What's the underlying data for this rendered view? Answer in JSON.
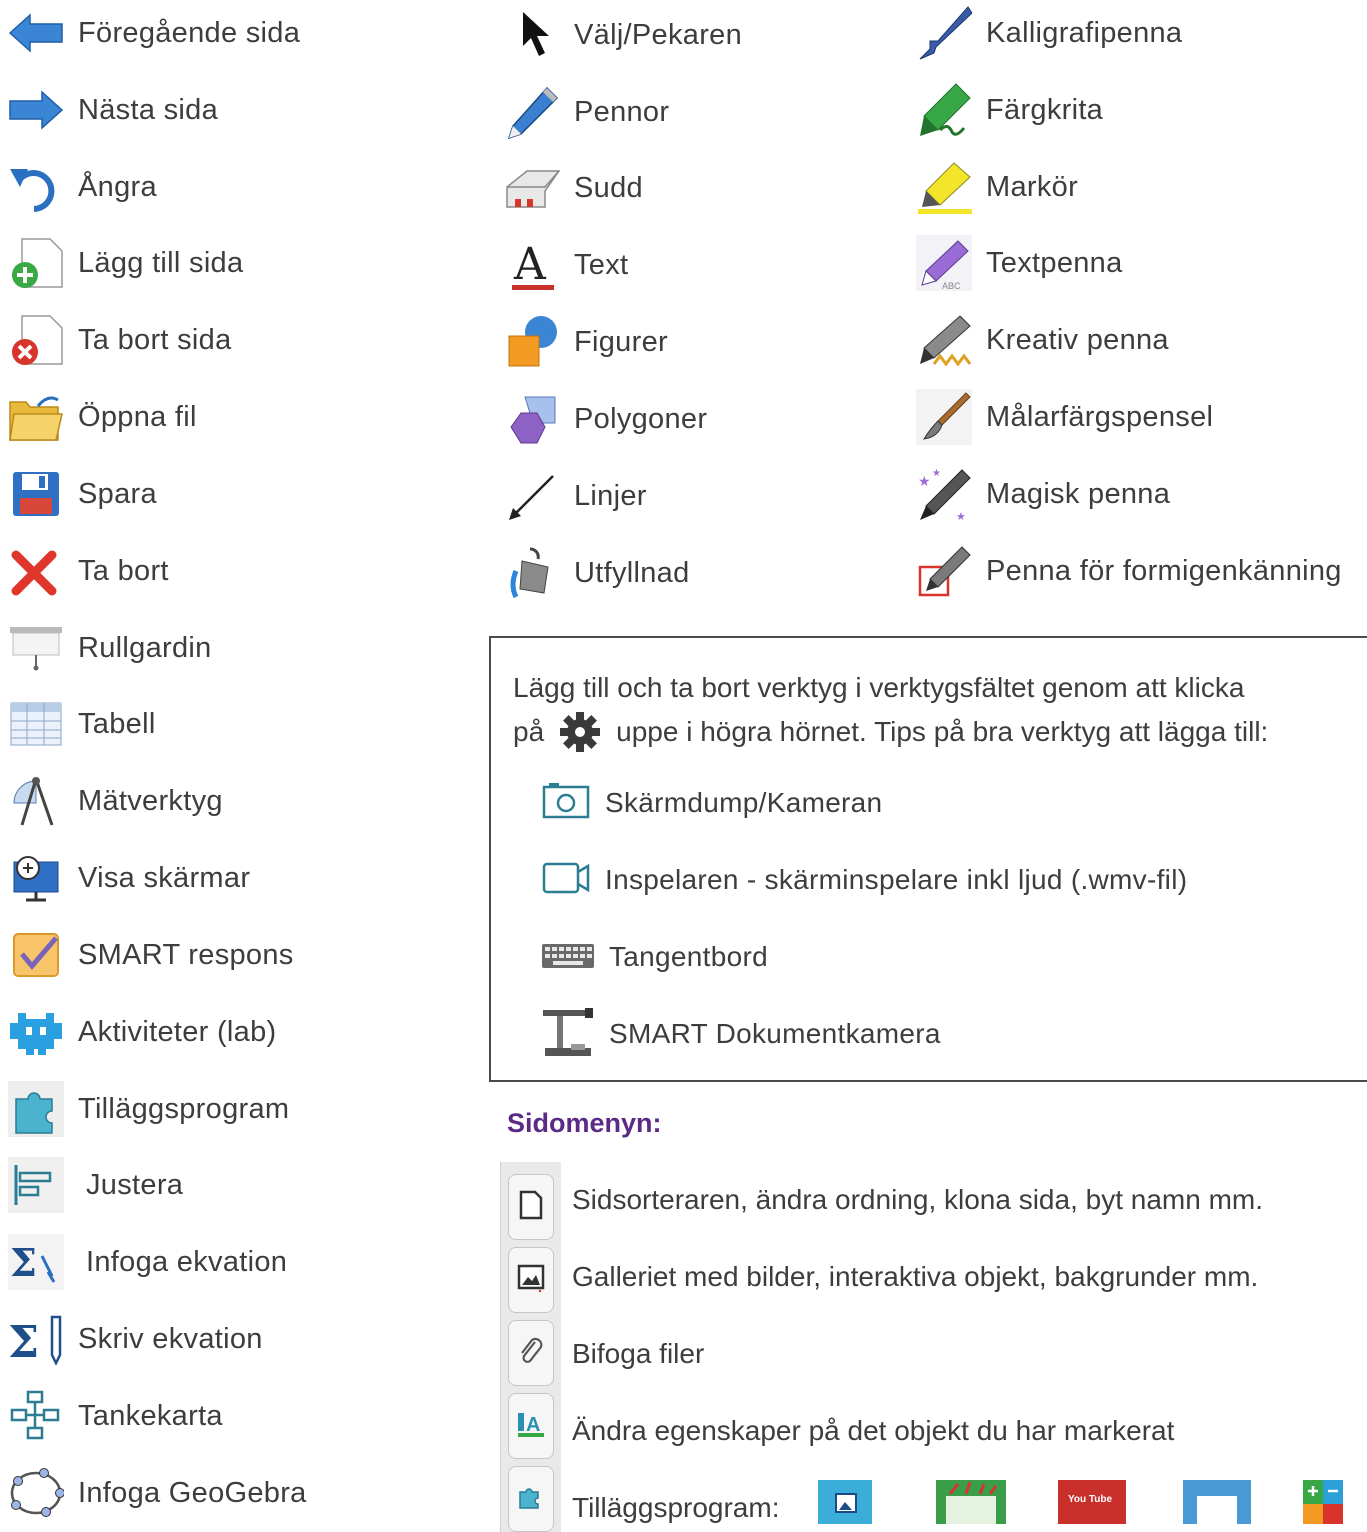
{
  "column1": [
    {
      "label": "Föregående sida",
      "icon": "arrow-left-icon"
    },
    {
      "label": "Nästa sida",
      "icon": "arrow-right-icon"
    },
    {
      "label": "Ångra",
      "icon": "undo-icon"
    },
    {
      "label": "Lägg till sida",
      "icon": "add-page-icon"
    },
    {
      "label": "Ta bort sida",
      "icon": "delete-page-icon"
    },
    {
      "label": "Öppna fil",
      "icon": "open-folder-icon"
    },
    {
      "label": "Spara",
      "icon": "save-icon"
    },
    {
      "label": "Ta bort",
      "icon": "delete-icon"
    },
    {
      "label": "Rullgardin",
      "icon": "screen-shade-icon"
    },
    {
      "label": "Tabell",
      "icon": "table-icon"
    },
    {
      "label": "Mätverktyg",
      "icon": "measurement-tools-icon"
    },
    {
      "label": "Visa skärmar",
      "icon": "view-screens-icon"
    },
    {
      "label": "SMART respons",
      "icon": "smart-response-icon"
    },
    {
      "label": "Aktiviteter (lab)",
      "icon": "activities-lab-icon"
    },
    {
      "label": "Tilläggsprogram",
      "icon": "addons-puzzle-icon"
    },
    {
      "label": "Justera",
      "icon": "align-icon"
    },
    {
      "label": "Infoga ekvation",
      "icon": "insert-equation-icon"
    },
    {
      "label": "Skriv ekvation",
      "icon": "write-equation-icon"
    },
    {
      "label": "Tankekarta",
      "icon": "mindmap-icon"
    },
    {
      "label": "Infoga GeoGebra",
      "icon": "geogebra-icon"
    }
  ],
  "column2": [
    {
      "label": "Välj/Pekaren",
      "icon": "pointer-icon"
    },
    {
      "label": "Pennor",
      "icon": "pen-icon"
    },
    {
      "label": "Sudd",
      "icon": "eraser-icon"
    },
    {
      "label": "Text",
      "icon": "text-icon"
    },
    {
      "label": "Figurer",
      "icon": "shapes-icon"
    },
    {
      "label": "Polygoner",
      "icon": "polygons-icon"
    },
    {
      "label": "Linjer",
      "icon": "lines-icon"
    },
    {
      "label": "Utfyllnad",
      "icon": "fill-bucket-icon"
    }
  ],
  "column3": [
    {
      "label": "Kalligrafipenna",
      "icon": "calligraphy-pen-icon"
    },
    {
      "label": "Färgkrita",
      "icon": "crayon-icon"
    },
    {
      "label": "Markör",
      "icon": "highlighter-icon"
    },
    {
      "label": "Textpenna",
      "icon": "text-pen-icon"
    },
    {
      "label": "Kreativ penna",
      "icon": "creative-pen-icon"
    },
    {
      "label": "Målarfärgspensel",
      "icon": "paint-brush-icon"
    },
    {
      "label": "Magisk penna",
      "icon": "magic-pen-icon"
    },
    {
      "label": "Penna för formigenkänning",
      "icon": "shape-recognition-pen-icon"
    }
  ],
  "tips": {
    "line1": "Lägg till och ta bort verktyg i verktygsfältet genom att klicka",
    "line2_before": "på",
    "line2_after": "uppe i högra hörnet. Tips på bra verktyg att lägga till:",
    "items": [
      {
        "label": "Skärmdump/Kameran",
        "icon": "camera-icon"
      },
      {
        "label": "Inspelaren - skärminspelare inkl ljud (.wmv-fil)",
        "icon": "recorder-icon"
      },
      {
        "label": "Tangentbord",
        "icon": "keyboard-icon"
      },
      {
        "label": "SMART Dokumentkamera",
        "icon": "document-camera-icon"
      }
    ]
  },
  "side_menu": {
    "heading": "Sidomenyn:",
    "items": [
      {
        "label": "Sidsorteraren, ändra ordning, klona sida, byt namn mm.",
        "icon": "page-sorter-icon"
      },
      {
        "label": "Galleriet med bilder, interaktiva objekt, bakgrunder mm.",
        "icon": "gallery-icon"
      },
      {
        "label": "Bifoga filer",
        "icon": "attachment-icon"
      },
      {
        "label": "Ändra egenskaper på det objekt du har markerat",
        "icon": "properties-icon"
      },
      {
        "label": "Tilläggsprogram:",
        "icon": "addons-icon"
      }
    ],
    "addon_labels": [
      "You Tube"
    ]
  }
}
